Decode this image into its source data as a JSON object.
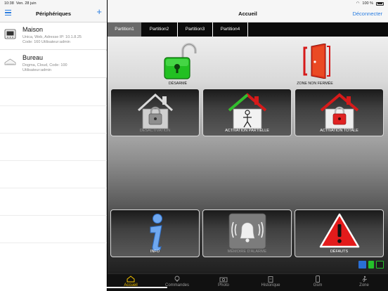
{
  "status_bar": {
    "time": "10:38",
    "date": "Ven. 28 juin",
    "battery": "100 %"
  },
  "sidebar": {
    "title": "Périphériques",
    "devices": [
      {
        "name": "Maison",
        "line1": "Unica, Web, Adresse IP: 10.1.8.25",
        "line2": "Code: 160 Utilisateur:admin"
      },
      {
        "name": "Bureau",
        "line1": "Dogma, Cloud, Code: 100",
        "line2": "Utilisateur:admin"
      }
    ]
  },
  "header": {
    "title": "Accueil",
    "disconnect": "Déconnecter"
  },
  "tabs": [
    "Partition1",
    "Partition2",
    "Partition3",
    "Partition4"
  ],
  "status": {
    "disarm_label": "DÉSARMÉ",
    "zone_label": "ZONE NON FERMÉE"
  },
  "buttons": {
    "deactivation": "DÉSACTIVATION",
    "partial": "ACTIVATION PARTIELLE",
    "total": "ACTIVATION TOTALE",
    "info": "INFO",
    "alarm_memory": "MÉMOIRE D'ALARME",
    "faults": "DÉFAUTS"
  },
  "bottom_tabs": [
    "Accueil",
    "Commandes",
    "Photo",
    "Historique",
    "Gsm",
    "Zone"
  ],
  "colors": {
    "accent": "#2a7de1",
    "active_tab": "#f5c400",
    "green": "#1fbf1f",
    "red": "#d61a1a"
  }
}
